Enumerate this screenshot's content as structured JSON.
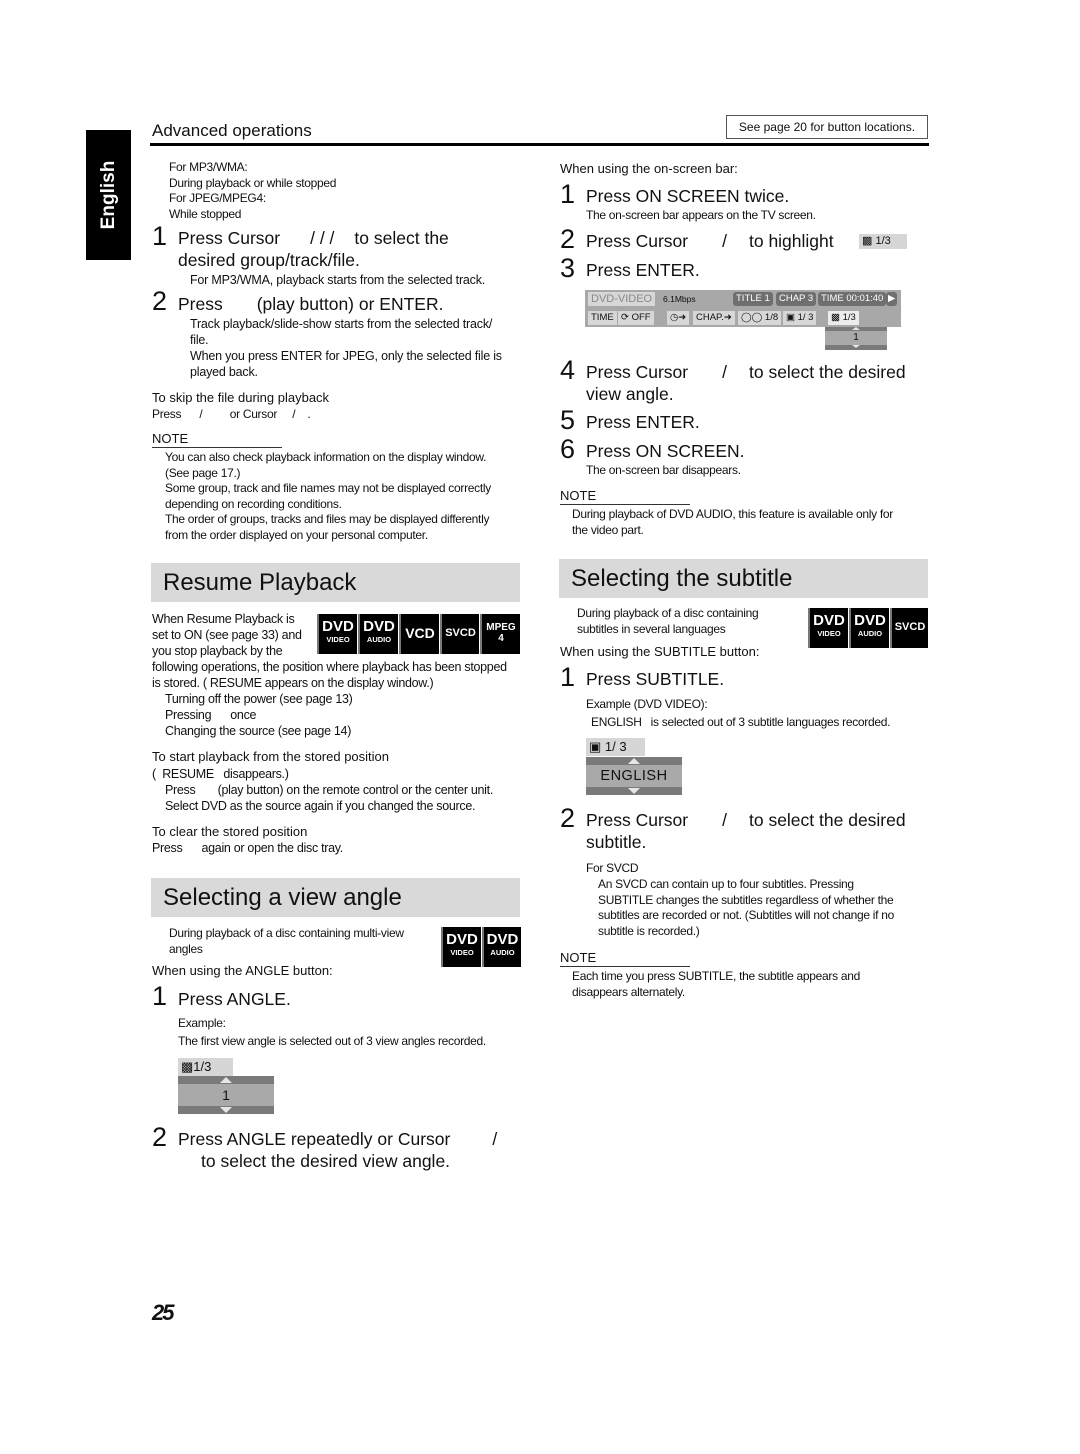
{
  "sidebar": {
    "language_tab": "English"
  },
  "header": {
    "section": "Advanced operations",
    "see_page": "See page 20 for button locations."
  },
  "left_top": {
    "conditions": [
      "For MP3/WMA:",
      "During playback or while stopped",
      "For JPEG/MPEG4:",
      "While stopped"
    ],
    "steps": [
      {
        "num": "1",
        "text_a": "Press Cursor",
        "text_b": "/   /   /",
        "text_c": "to select the",
        "text_d": "desired group/track/file.",
        "detail": [
          "For MP3/WMA, playback starts from the selected track."
        ]
      },
      {
        "num": "2",
        "text_a": "Press",
        "text_c": "(play button) or ENTER.",
        "detail": [
          "Track playback/slide-show starts from the selected track/",
          "file.",
          "When you press ENTER for JPEG, only the selected file is",
          "played back."
        ]
      }
    ],
    "skip_title": "To skip the file during playback",
    "skip_text": "Press      /         or Cursor     /    .",
    "note_label": "NOTE",
    "notes": [
      "You can also check playback information on the display window.",
      "(See page 17.)",
      "Some group, track and file names may not be displayed correctly",
      "depending on recording conditions.",
      "The order of groups, tracks and files may be displayed differently",
      "from the order displayed on your personal computer."
    ]
  },
  "resume": {
    "title": "Resume Playback",
    "intro": [
      "When Resume Playback is",
      "set to  ON  (see page 33) and",
      "you stop playback by the"
    ],
    "badges": [
      {
        "big": "DVD",
        "sub": "VIDEO"
      },
      {
        "big": "DVD",
        "sub": "AUDIO"
      },
      {
        "big": "VCD",
        "sub": ""
      },
      {
        "big": "SVCD",
        "sub": ""
      },
      {
        "big": "MPEG",
        "sub": "4"
      }
    ],
    "body": [
      "following operations, the position where playback has been stopped",
      "is stored. (  RESUME   appears on the display window.)"
    ],
    "ops": [
      "Turning off the power (see page 13)",
      "Pressing      once",
      "Changing the source (see page 14)"
    ],
    "start_title": "To start playback from the stored position",
    "start_lines": [
      "(  RESUME   disappears.)",
      "Press       (play button) on the remote control or the center unit.",
      "Select DVD as the source again if you changed the source."
    ],
    "clear_title": "To clear the stored position",
    "clear_text": "Press      again or open the disc tray."
  },
  "view_angle": {
    "title": "Selecting a view angle",
    "intro": [
      "During playback of a disc containing multi-view",
      "angles"
    ],
    "badges": [
      {
        "big": "DVD",
        "sub": "VIDEO"
      },
      {
        "big": "DVD",
        "sub": "AUDIO"
      }
    ],
    "when": "When using the ANGLE button:",
    "step1": "Press ANGLE.",
    "example_label": "Example:",
    "example_text": "The first view angle is selected out of 3 view angles recorded.",
    "osd_label": "1/3",
    "osd_value": "1",
    "step2_a": "Press ANGLE repeatedly or Cursor",
    "step2_b": "/",
    "step2_c": "to select the desired view angle."
  },
  "onscreen": {
    "when": "When using the on-screen bar:",
    "step1": "Press ON SCREEN twice.",
    "step1_detail": "The on-screen bar appears on the TV screen.",
    "step2_a": "Press Cursor",
    "step2_b": "/",
    "step2_c": "to highlight",
    "step2_chip": "1/3",
    "step3": "Press ENTER.",
    "bar": {
      "source": "DVD-VIDEO",
      "bitrate": "6.1Mbps",
      "title": "TITLE  1",
      "chap": "CHAP  3",
      "time": "TIME 00:01:40",
      "row2": [
        "TIME",
        "OFF",
        "CHAP.",
        "1/8",
        "1/ 3",
        "1/3"
      ],
      "picker_value": "1"
    },
    "step4_a": "Press Cursor",
    "step4_b": "/",
    "step4_c": "to select the desired",
    "step4_d": "view angle.",
    "step5": "Press ENTER.",
    "step6": "Press ON SCREEN.",
    "step6_detail": "The on-screen bar disappears.",
    "note_label": "NOTE",
    "notes": [
      "During playback of DVD AUDIO, this feature is available only for",
      "the video part."
    ]
  },
  "subtitle": {
    "title": "Selecting the subtitle",
    "intro": [
      "During playback of a disc containing",
      "subtitles in several languages"
    ],
    "badges": [
      {
        "big": "DVD",
        "sub": "VIDEO"
      },
      {
        "big": "DVD",
        "sub": "AUDIO"
      },
      {
        "big": "SVCD",
        "sub": ""
      }
    ],
    "when": "When using the SUBTITLE button:",
    "step1": "Press SUBTITLE.",
    "example_label": "Example (DVD VIDEO):",
    "example_text": "ENGLISH   is selected out of 3 subtitle languages recorded.",
    "osd_label": "1/ 3",
    "osd_value": "ENGLISH",
    "step2_a": "Press Cursor",
    "step2_b": "/",
    "step2_c": "to select the desired",
    "step2_d": "subtitle.",
    "svcd_label": "For SVCD",
    "svcd_text": [
      "An SVCD can contain up to four subtitles. Pressing",
      "SUBTITLE changes the subtitles regardless of whether the",
      "subtitles are recorded or not. (Subtitles will not change if no",
      "subtitle is recorded.)"
    ],
    "note_label": "NOTE",
    "notes": [
      "Each time you press SUBTITLE, the subtitle appears and",
      "disappears alternately."
    ]
  },
  "footer": {
    "page_number": "25"
  }
}
